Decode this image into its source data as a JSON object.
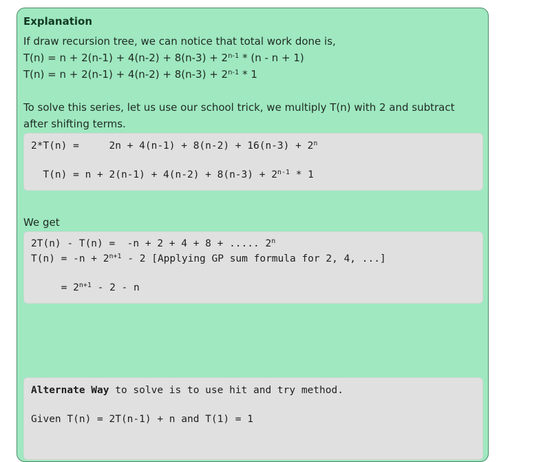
{
  "explanation": {
    "title": "Explanation",
    "intro": "If draw recursion tree, we can notice that total work done is,",
    "eq1": {
      "pre": "T(n) = n + 2(n-1) + 4(n-2) + 8(n-3) + 2",
      "sup": "n-1",
      "post": " * (n - n + 1)"
    },
    "eq2": {
      "pre": "T(n) = n + 2(n-1) + 4(n-2) + 8(n-3) + 2",
      "sup": "n-1",
      "post": " * 1"
    },
    "trick": "To solve this series, let us use our school trick, we multiply T(n) with 2 and subtract after shifting terms.",
    "code1": {
      "l1": {
        "pre": "2*T(n) =     2n + 4(n-1) + 8(n-2) + 16(n-3) + 2",
        "sup": "n",
        "post": ""
      },
      "l2": {
        "pre": "  T(n) = n + 2(n-1) + 4(n-2) + 8(n-3) + 2",
        "sup": "n-1",
        "post": " * 1"
      }
    },
    "we_get": "We get",
    "code2": {
      "l1": {
        "pre": "2T(n) - T(n) =  -n + 2 + 4 + 8 + ..... 2",
        "sup": "n",
        "post": ""
      },
      "l2": {
        "pre": "T(n) = -n + 2",
        "sup": "n+1",
        "post": " - 2 [Applying GP sum formula for 2, 4, ...]"
      },
      "l3": {
        "pre": "     = 2",
        "sup": "n+1",
        "post": " - 2 - n"
      }
    },
    "alternate": {
      "bold": "Alternate Way",
      "rest": " to solve is to use hit and try method.",
      "given": "Given T(n) = 2T(n-1) + n and T(1) = 1"
    }
  }
}
